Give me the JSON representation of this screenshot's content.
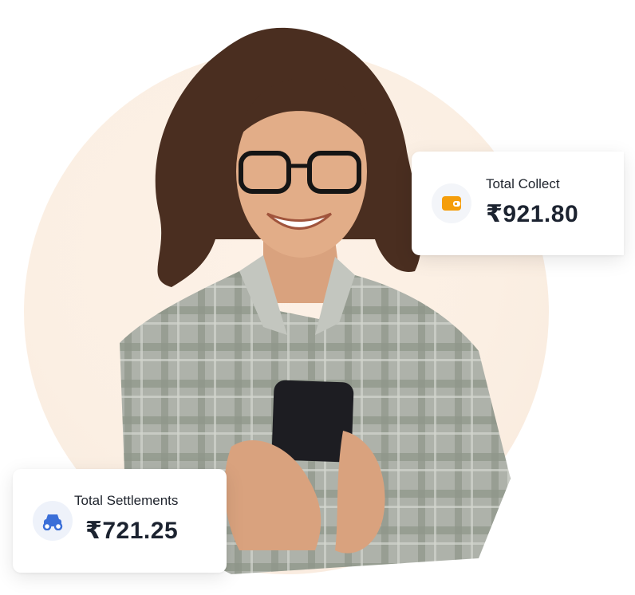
{
  "cards": {
    "collect": {
      "label": "Total Collect",
      "value": "₹921.80",
      "icon": "wallet-icon",
      "icon_color": "#f59e0b"
    },
    "settlements": {
      "label": "Total Settlements",
      "value": "₹721.25",
      "icon": "money-settlement-icon",
      "icon_color": "#3b6fd8"
    }
  },
  "colors": {
    "circle_bg": "#fbefe3",
    "shirt": "#9ea39a",
    "hair": "#4a2e20"
  }
}
